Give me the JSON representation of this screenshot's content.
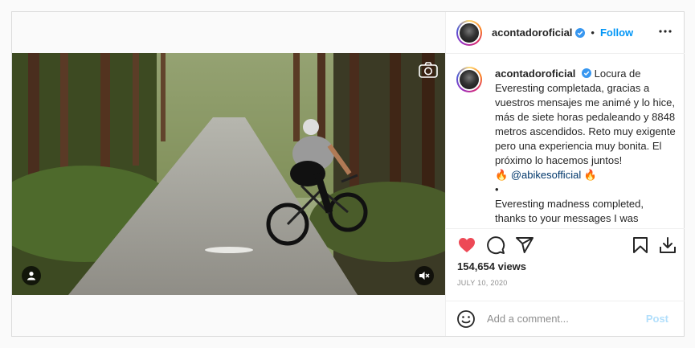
{
  "post": {
    "username": "acontadoroficial",
    "follow_label": "Follow",
    "separator": "•",
    "caption": {
      "username": "acontadoroficial",
      "text_es": "Locura de Everesting completada, gracias a vuestros mensajes me animé y lo hice, más de siete horas pedaleando y 8848 metros ascendidos. Reto muy exigente pero una experiencia muy bonita. El próximo lo hacemos juntos!",
      "fire_left": "🔥",
      "mention": "@abikesofficial",
      "fire_right": "🔥",
      "bullet": "•",
      "text_en": "Everesting madness completed, thanks to your messages I was"
    },
    "views": "154,654 views",
    "date": "JULY 10, 2020",
    "comment": {
      "placeholder": "Add a comment...",
      "post_label": "Post"
    }
  },
  "icons": {
    "verified": "verified-badge-icon",
    "more": "more-options-icon",
    "camera": "camera-icon",
    "user_tag": "user-tag-icon",
    "mute": "muted-speaker-icon",
    "like": "heart-icon",
    "comment": "comment-icon",
    "share": "share-icon",
    "save": "bookmark-icon",
    "download": "download-icon",
    "emoji": "emoji-icon"
  },
  "colors": {
    "accent": "#0095f6",
    "like": "#ed4956",
    "post_disabled": "#b2dffc",
    "muted_text": "#8e8e8e"
  }
}
